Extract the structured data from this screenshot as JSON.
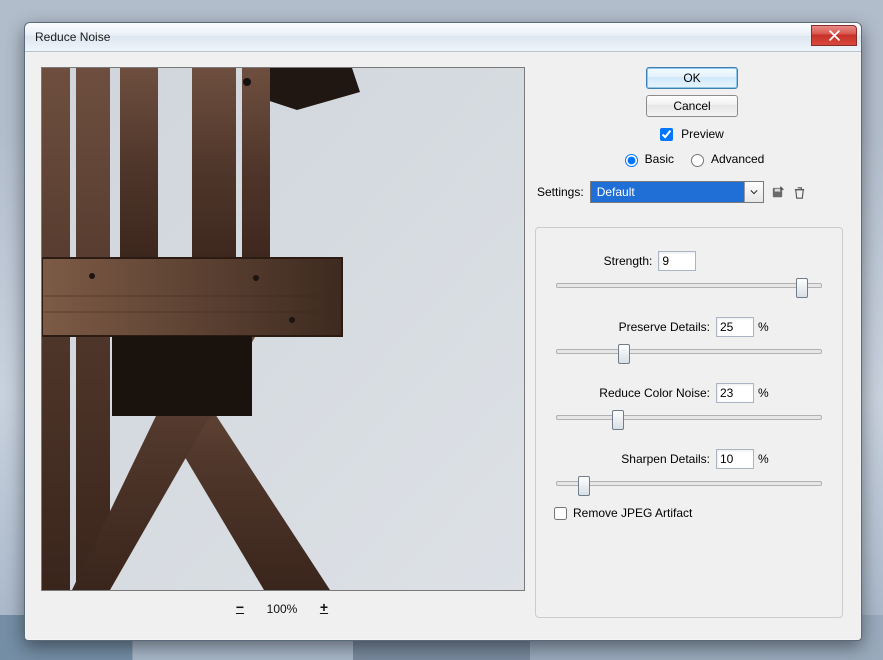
{
  "window": {
    "title": "Reduce Noise"
  },
  "buttons": {
    "ok": "OK",
    "cancel": "Cancel"
  },
  "preview_checkbox": {
    "label": "Preview",
    "checked": true
  },
  "mode": {
    "basic_label": "Basic",
    "advanced_label": "Advanced",
    "selected": "basic"
  },
  "settings": {
    "label": "Settings:",
    "value": "Default"
  },
  "zoom": {
    "out_label": "−",
    "in_label": "+",
    "value": "100%"
  },
  "params": {
    "strength": {
      "label": "Strength:",
      "value": "9",
      "unit": "",
      "pos": 92
    },
    "preserve": {
      "label": "Preserve Details:",
      "value": "25",
      "unit": "%",
      "pos": 25
    },
    "reduce_color": {
      "label": "Reduce Color Noise:",
      "value": "23",
      "unit": "%",
      "pos": 23
    },
    "sharpen": {
      "label": "Sharpen Details:",
      "value": "10",
      "unit": "%",
      "pos": 10
    }
  },
  "remove_jpeg": {
    "label": "Remove JPEG Artifact",
    "checked": false
  }
}
